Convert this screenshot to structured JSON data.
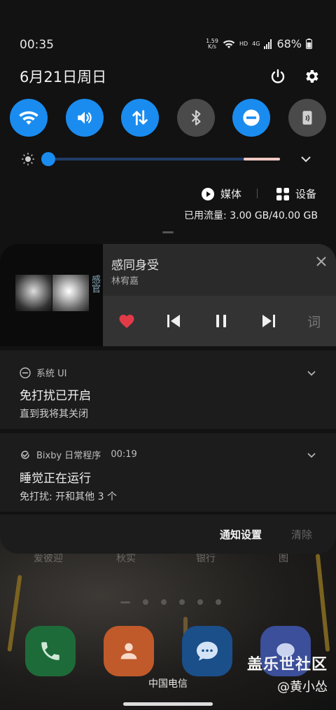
{
  "status_bar": {
    "time": "00:35",
    "net_speed_value": "1.59",
    "net_speed_unit": "K/s",
    "hd_label": "HD",
    "network_type": "4G",
    "battery": "68%"
  },
  "date": "6月21日周日",
  "quick_settings": {
    "toggles": [
      {
        "icon": "wifi-icon",
        "state": "on"
      },
      {
        "icon": "sound-icon",
        "state": "on"
      },
      {
        "icon": "mobile-data-icon",
        "state": "on"
      },
      {
        "icon": "bluetooth-icon",
        "state": "off"
      },
      {
        "icon": "do-not-disturb-icon",
        "state": "on"
      },
      {
        "icon": "nfc-icon",
        "state": "off"
      }
    ],
    "brightness_level": 0.03,
    "media_label": "媒体",
    "device_label": "设备",
    "data_usage": "已用流量: 3.00 GB/40.00 GB"
  },
  "media_player": {
    "title": "感同身受",
    "artist": "林宥嘉",
    "album_text": "感官",
    "lyrics_label": "词"
  },
  "notifications": [
    {
      "app": "系统 UI",
      "time": "",
      "title": "免打扰已开启",
      "body": "直到我将其关闭"
    },
    {
      "app": "Bixby 日常程序",
      "time": "00:19",
      "title": "睡觉正在运行",
      "body": "免打扰: 开和其他 3 个"
    }
  ],
  "panel_footer": {
    "settings_label": "通知设置",
    "clear_label": "清除"
  },
  "home_screen": {
    "labels": [
      "爱彼迎",
      "秋实",
      "银行",
      "图"
    ],
    "dock": [
      {
        "icon": "phone-icon",
        "color": "#1e6b3a"
      },
      {
        "icon": "contacts-icon",
        "color": "#c05a2a"
      },
      {
        "icon": "messages-icon",
        "color": "#1a4f8a"
      },
      {
        "icon": "chat-icon",
        "color": "#3b4f9a"
      }
    ]
  },
  "carrier": "中国电信",
  "watermark": {
    "line1": "盖乐世社区",
    "line2": "@黄小怂"
  },
  "colors": {
    "accent": "#1a8cf0",
    "heart": "#e23b48"
  }
}
